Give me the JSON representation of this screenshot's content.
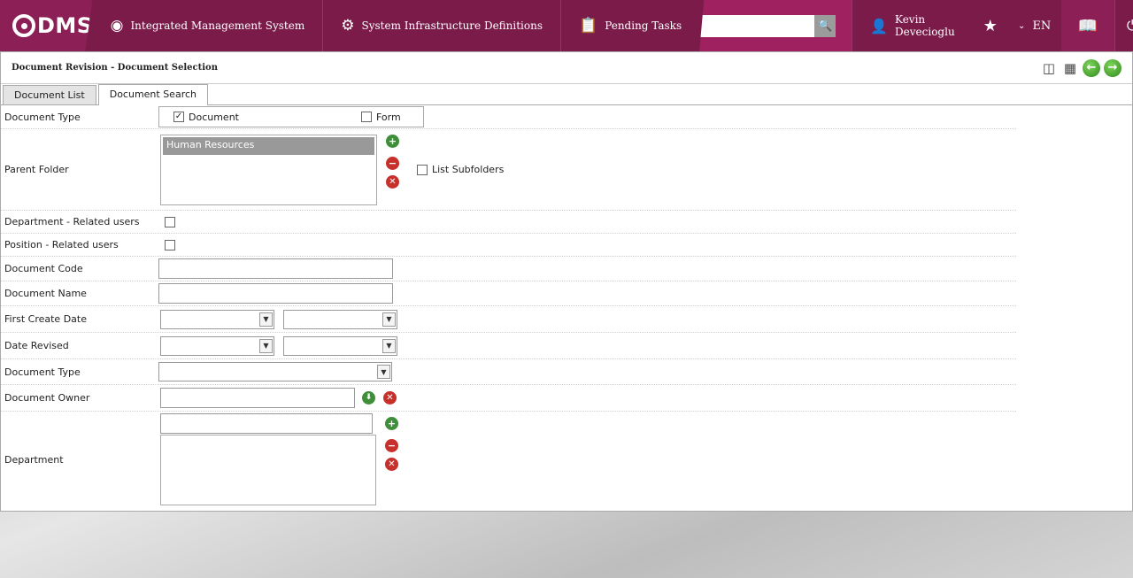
{
  "topbar": {
    "logo_text": "DMS",
    "nav": [
      {
        "label": "Integrated Management System",
        "icon": "q-logo-icon"
      },
      {
        "label": "System Infrastructure Definitions",
        "icon": "gear-icon"
      },
      {
        "label": "Pending Tasks",
        "icon": "clipboard-icon"
      }
    ],
    "search_placeholder": "",
    "user_name": "Kevin Devecioglu",
    "language": "EN",
    "colors": {
      "bar": "#7a1b4a",
      "accent": "#a0215f"
    }
  },
  "panel": {
    "title": "Document Revision - Document Selection"
  },
  "tabs": [
    {
      "label": "Document List",
      "active": false
    },
    {
      "label": "Document Search",
      "active": true
    }
  ],
  "form": {
    "document_type_label": "Document Type",
    "doc_option_document": "Document",
    "doc_option_form": "Form",
    "parent_folder_label": "Parent Folder",
    "parent_folder_selected": "Human Resources",
    "list_subfolders_label": "List Subfolders",
    "department_related_label": "Department - Related users",
    "position_related_label": "Position - Related users",
    "document_code_label": "Document Code",
    "document_name_label": "Document Name",
    "first_create_date_label": "First Create Date",
    "date_revised_label": "Date Revised",
    "document_type2_label": "Document Type",
    "document_owner_label": "Document Owner",
    "department_label": "Department"
  }
}
